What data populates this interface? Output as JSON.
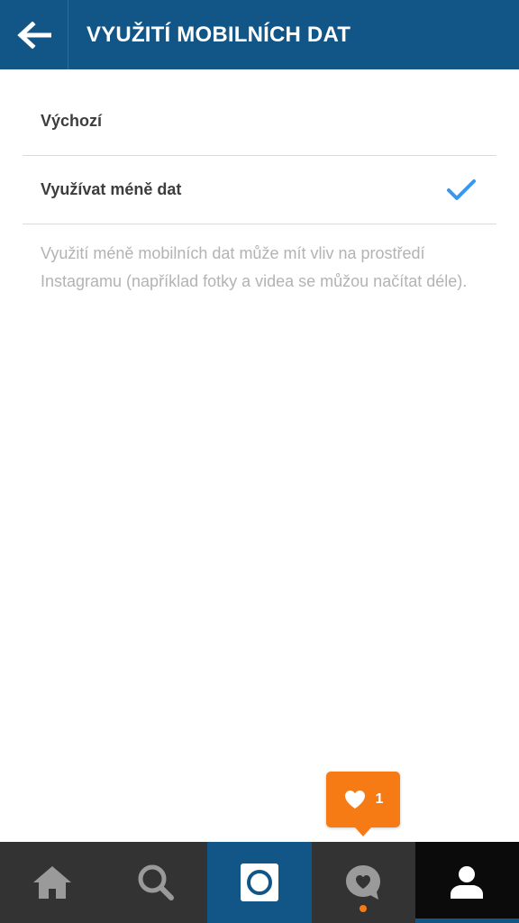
{
  "header": {
    "title": "VYUŽITÍ MOBILNÍCH DAT",
    "back_icon": "arrow-left-icon"
  },
  "options": [
    {
      "label": "Výchozí",
      "selected": false
    },
    {
      "label": "Využívat méně dat",
      "selected": true
    }
  ],
  "note": "Využití méně mobilních dat může mít vliv na prostředí Instagramu (například fotky a videa se můžou načítat déle).",
  "notification": {
    "icon": "heart-icon",
    "count": "1",
    "color": "#f77b15"
  },
  "tabbar": {
    "tabs": [
      {
        "icon": "home-icon"
      },
      {
        "icon": "search-icon"
      },
      {
        "icon": "camera-icon"
      },
      {
        "icon": "activity-icon"
      },
      {
        "icon": "profile-icon"
      }
    ]
  },
  "colors": {
    "brand": "#125688",
    "check": "#3897f0",
    "notification": "#f77b15"
  }
}
